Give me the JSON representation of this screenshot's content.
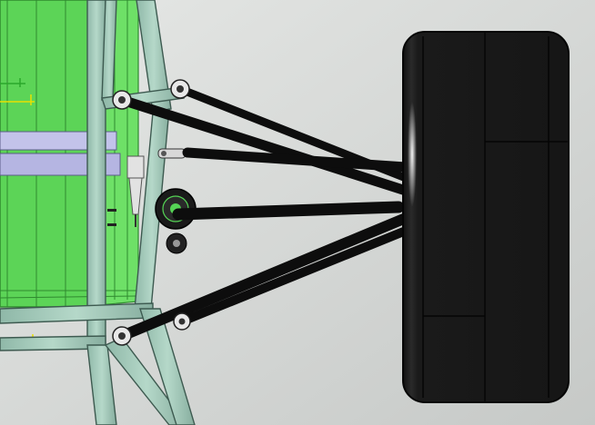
{
  "viewport": {
    "description_label": "",
    "colors": {
      "background_light": "#e4e6e4",
      "background_dark": "#c9ccca",
      "chassis_panel": "#5fd45a",
      "chassis_panel_edge": "#2f8a2f",
      "frame_tube": "#9fc6b6",
      "frame_tube_edge": "#3d5a50",
      "tie_rod_bar": "#b9b9e6",
      "link": "#0d0d0d",
      "tire": "#1c1c1c",
      "tire_edge": "#050505",
      "highlight": "#ffffff",
      "marker": "#e8e000"
    }
  },
  "icons": {
    "origin_marker": "axis-origin-icon",
    "rod_end": "rod-end-joint-icon"
  }
}
